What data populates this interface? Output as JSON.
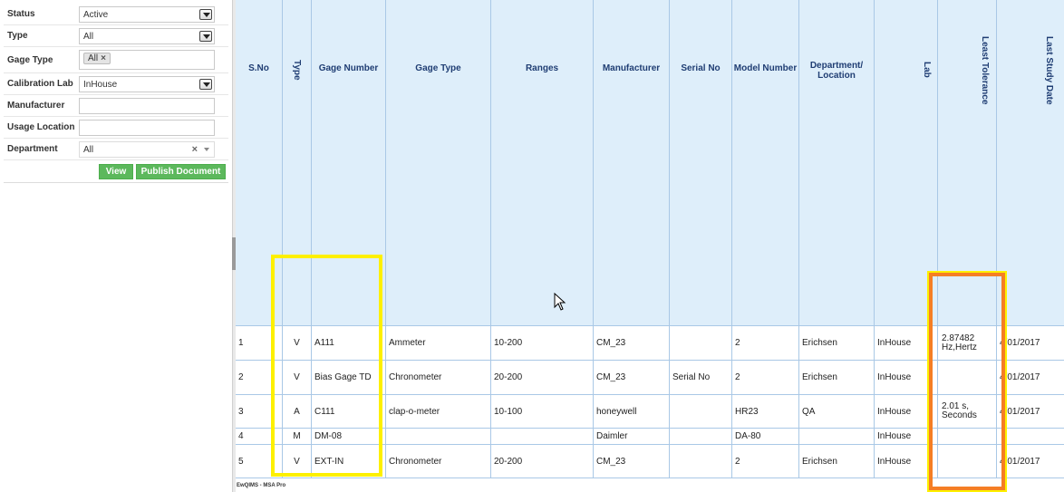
{
  "filters": {
    "status": {
      "label": "Status",
      "value": "Active"
    },
    "type": {
      "label": "Type",
      "value": "All"
    },
    "gage_type": {
      "label": "Gage Type",
      "tag": "All",
      "tag_remove": "×"
    },
    "calibration_lab": {
      "label": "Calibration Lab",
      "value": "InHouse"
    },
    "manufacturer": {
      "label": "Manufacturer",
      "value": ""
    },
    "usage_location": {
      "label": "Usage Location",
      "value": ""
    },
    "department": {
      "label": "Department",
      "value": "All",
      "clear": "×"
    }
  },
  "buttons": {
    "view": "View",
    "publish": "Publish Document"
  },
  "grid": {
    "headers": {
      "sno": "S.No",
      "type": "Type",
      "gage_number": "Gage Number",
      "gage_type": "Gage Type",
      "ranges": "Ranges",
      "manufacturer": "Manufacturer",
      "serial_no": "Serial No",
      "model_number": "Model Number",
      "department_line1": "Department/",
      "department_line2": "Location",
      "lab": "Lab",
      "least_tolerance": "Least  Tolerance",
      "last_study_date": "Last Study Date"
    },
    "rows": [
      {
        "sno": "1",
        "type": "V",
        "gage_number": "A111",
        "gage_type": "Ammeter",
        "ranges": "10-200",
        "manufacturer": "CM_23",
        "serial_no": "",
        "model_number": "2",
        "department": "Erichsen",
        "lab": "InHouse",
        "tol1": "2.87482",
        "tol2": "Hz,Hertz",
        "date": "4/01/2017"
      },
      {
        "sno": "2",
        "type": "V",
        "gage_number": "Bias Gage TD",
        "gage_type": "Chronometer",
        "ranges": "20-200",
        "manufacturer": "CM_23",
        "serial_no": "Serial No",
        "model_number": "2",
        "department": "Erichsen",
        "lab": "InHouse",
        "tol1": "",
        "tol2": "",
        "date": "4/01/2017"
      },
      {
        "sno": "3",
        "type": "A",
        "gage_number": "C111",
        "gage_type": "clap-o-meter",
        "ranges": "10-100",
        "manufacturer": "honeywell",
        "serial_no": "",
        "model_number": "HR23",
        "department": "QA",
        "lab": "InHouse",
        "tol1": "2.01 s,",
        "tol2": "Seconds",
        "date": "4/01/2017"
      },
      {
        "sno": "4",
        "type": "M",
        "gage_number": "DM-08",
        "gage_type": "",
        "ranges": "",
        "manufacturer": "Daimler",
        "serial_no": "",
        "model_number": "DA-80",
        "department": "",
        "lab": "InHouse",
        "tol1": "",
        "tol2": "",
        "date": ""
      },
      {
        "sno": "5",
        "type": "V",
        "gage_number": "EXT-IN",
        "gage_type": "Chronometer",
        "ranges": "20-200",
        "manufacturer": "CM_23",
        "serial_no": "",
        "model_number": "2",
        "department": "Erichsen",
        "lab": "InHouse",
        "tol1": "",
        "tol2": "",
        "date": "4/01/2017"
      }
    ]
  },
  "footer": "EwQIMS - MSA Pro",
  "colors": {
    "header_bg": "#deeefa",
    "button_green": "#5cb85c",
    "highlight_yellow": "#fdf000",
    "highlight_orange": "#f57e24"
  }
}
